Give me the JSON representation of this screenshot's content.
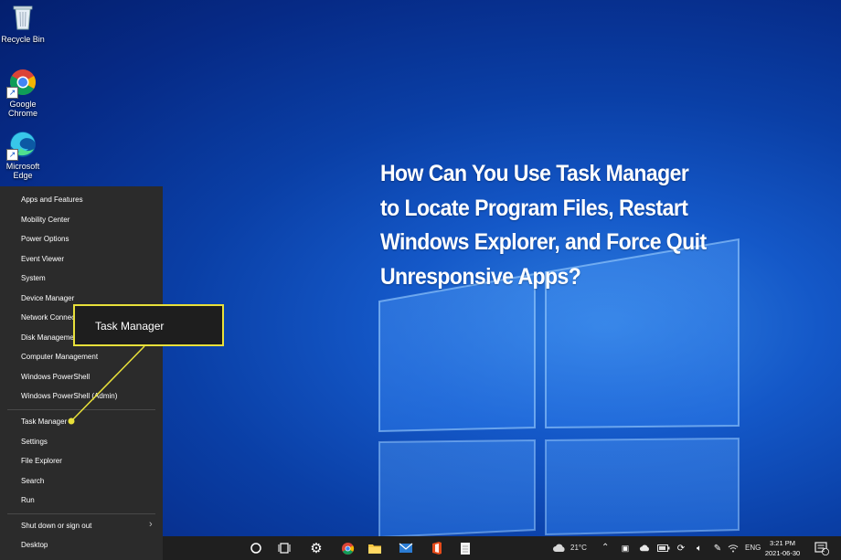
{
  "desktop": {
    "icons": [
      {
        "label": "Recycle Bin",
        "icon": "recycle-bin-icon"
      },
      {
        "label": "Google Chrome",
        "icon": "chrome-icon"
      },
      {
        "label": "Microsoft Edge",
        "icon": "edge-icon"
      }
    ],
    "headline": [
      "How Can You Use Task Manager",
      "to Locate Program Files, Restart",
      "Windows Explorer, and Force Quit",
      "Unresponsive Apps?"
    ]
  },
  "power_menu": {
    "items": [
      "Apps and Features",
      "Mobility Center",
      "Power Options",
      "Event Viewer",
      "System",
      "Device Manager",
      "Network Connections",
      "Disk Management",
      "Computer Management",
      "Windows PowerShell",
      "Windows PowerShell (Admin)",
      "Task Manager",
      "Settings",
      "File Explorer",
      "Search",
      "Run",
      "Shut down or sign out",
      "Desktop"
    ]
  },
  "callout": {
    "label": "Task Manager"
  },
  "taskbar": {
    "weather": "21°C",
    "language": "ENG",
    "time": "3:21 PM",
    "date": "2021-06-30",
    "notification_count": "2"
  },
  "colors": {
    "highlight": "#e8e03a",
    "menu_bg": "#2b2b2b",
    "taskbar_bg": "#1f1f1f"
  }
}
